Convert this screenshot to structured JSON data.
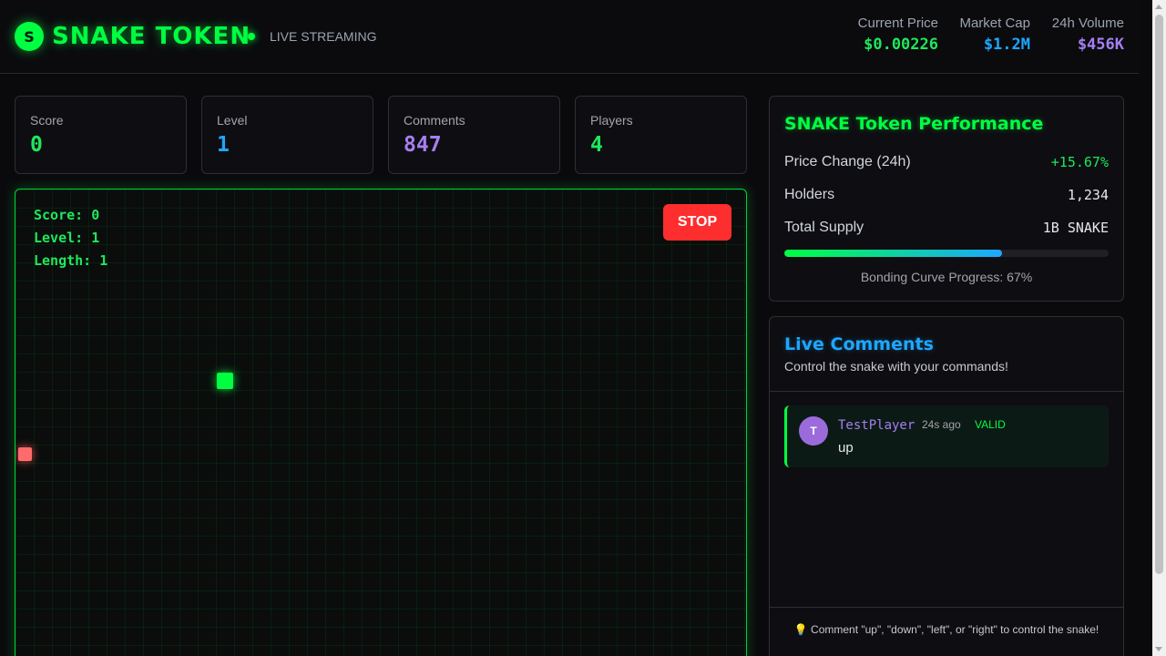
{
  "header": {
    "logo_letter": "S",
    "brand": "SNAKE TOKEN",
    "live_label": "LIVE STREAMING",
    "stats": [
      {
        "label": "Current Price",
        "value": "$0.00226",
        "color": "#1ee85a"
      },
      {
        "label": "Market Cap",
        "value": "$1.2M",
        "color": "#1ea7ff"
      },
      {
        "label": "24h Volume",
        "value": "$456K",
        "color": "#a57ff2"
      }
    ]
  },
  "cards": [
    {
      "label": "Score",
      "value": "0",
      "color": "#1ee85a"
    },
    {
      "label": "Level",
      "value": "1",
      "color": "#1ea7ff"
    },
    {
      "label": "Comments",
      "value": "847",
      "color": "#a57ff2"
    },
    {
      "label": "Players",
      "value": "4",
      "color": "#1ee85a"
    }
  ],
  "game": {
    "hud_score": "Score: 0",
    "hud_level": "Level: 1",
    "hud_length": "Length: 1",
    "stop_label": "STOP"
  },
  "performance": {
    "title": "SNAKE Token Performance",
    "rows": [
      {
        "label": "Price Change (24h)",
        "value": "+15.67%",
        "color": "#1ee85a"
      },
      {
        "label": "Holders",
        "value": "1,234",
        "color": "#e5e7eb"
      },
      {
        "label": "Total Supply",
        "value": "1B SNAKE",
        "color": "#e5e7eb"
      }
    ],
    "bonding_progress": 0.67,
    "bonding_label": "Bonding Curve Progress: 67%"
  },
  "comments": {
    "title": "Live Comments",
    "subtitle": "Control the snake with your commands!",
    "items": [
      {
        "avatar": "T",
        "user": "TestPlayer",
        "time": "24s ago",
        "status": "VALID",
        "text": "up"
      }
    ],
    "tip": "💡 Comment \"up\", \"down\", \"left\", or \"right\" to control the snake!"
  }
}
